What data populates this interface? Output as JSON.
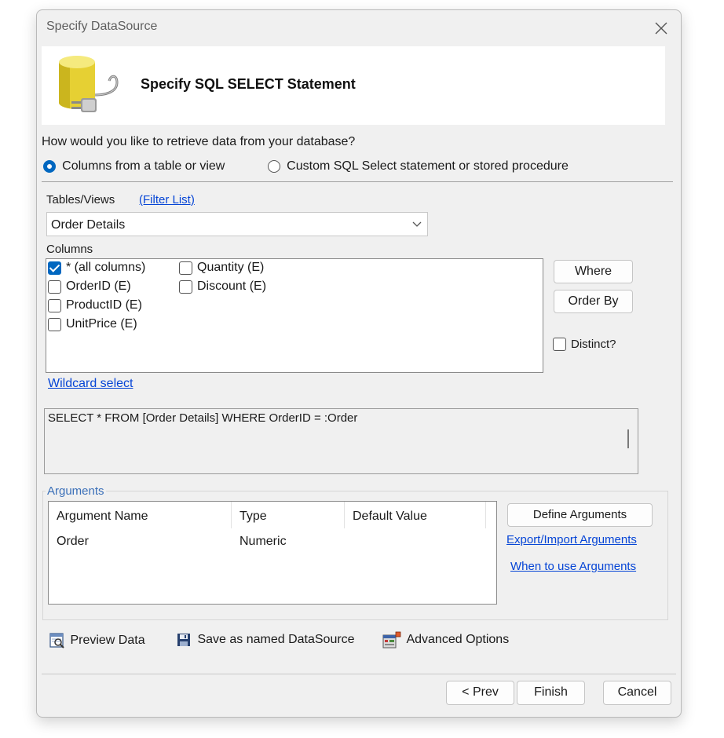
{
  "window": {
    "title": "Specify DataSource"
  },
  "header": {
    "title": "Specify SQL SELECT Statement"
  },
  "question": "How would you like to retrieve data from your database?",
  "retrieval": {
    "option_columns": "Columns from a table or view",
    "option_custom": "Custom SQL Select statement or stored procedure"
  },
  "tables": {
    "label": "Tables/Views",
    "filter_link": "(Filter List)",
    "selected": "Order Details"
  },
  "columns": {
    "label": "Columns",
    "items": [
      "* (all columns)",
      "OrderID (E)",
      "ProductID (E)",
      "UnitPrice (E)",
      "Quantity (E)",
      "Discount (E)"
    ],
    "wildcard_link": "Wildcard select"
  },
  "buttons": {
    "where": "Where",
    "order_by": "Order By",
    "distinct": "Distinct?",
    "define_arguments": "Define Arguments",
    "prev": "< Prev",
    "finish": "Finish",
    "cancel": "Cancel"
  },
  "sql": {
    "text": "SELECT * FROM [Order Details]  WHERE OrderID = :Order"
  },
  "arguments": {
    "group_label": "Arguments",
    "headers": [
      "Argument Name",
      "Type",
      "Default Value"
    ],
    "rows": [
      [
        "Order",
        "Numeric",
        ""
      ]
    ],
    "export_link": "Export/Import Arguments",
    "when_link": "When to use Arguments"
  },
  "toolbar": {
    "preview": "Preview Data",
    "save": "Save as named DataSource",
    "advanced": "Advanced Options"
  },
  "colors": {
    "accent": "#0067c0",
    "link": "#0645d6",
    "db_yellow": "#e8d33a"
  }
}
